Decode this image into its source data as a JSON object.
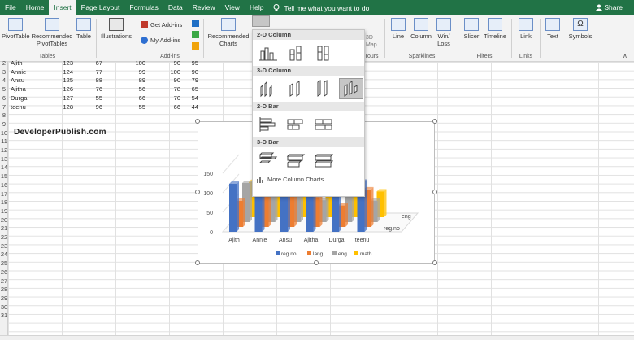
{
  "ribbon_tabs": [
    "File",
    "Home",
    "Insert",
    "Page Layout",
    "Formulas",
    "Data",
    "Review",
    "View",
    "Help"
  ],
  "active_tab": "Insert",
  "tell_me": "Tell me what you want to do",
  "share": "Share",
  "ribbon": {
    "pivottable": "PivotTable",
    "recommended_pivottables": "Recommended PivotTables",
    "table": "Table",
    "tables_group": "Tables",
    "illustrations": "Illustrations",
    "get_addins": "Get Add-ins",
    "my_addins": "My Add-ins",
    "addins_group": "Add-ins",
    "recommended_charts": "Recommended Charts",
    "tours_group": "Tours",
    "line": "Line",
    "column": "Column",
    "win_loss": "Win/ Loss",
    "sparklines_group": "Sparklines",
    "slicer": "Slicer",
    "timeline": "Timeline",
    "filters_group": "Filters",
    "link": "Link",
    "links_group": "Links",
    "text": "Text",
    "symbols": "Symbols",
    "map_partial": "3D",
    "map_partial2": "Map"
  },
  "rows": [
    {
      "num": "2",
      "name": "Ajith",
      "a": "123",
      "b": "67",
      "c": "100",
      "d": "90",
      "e": "95"
    },
    {
      "num": "3",
      "name": "Annie",
      "a": "124",
      "b": "77",
      "c": "99",
      "d": "100",
      "e": "90"
    },
    {
      "num": "4",
      "name": "Ansu",
      "a": "125",
      "b": "88",
      "c": "89",
      "d": "90",
      "e": "79"
    },
    {
      "num": "5",
      "name": "Ajitha",
      "a": "126",
      "b": "76",
      "c": "56",
      "d": "78",
      "e": "65"
    },
    {
      "num": "6",
      "name": "Durga",
      "a": "127",
      "b": "55",
      "c": "66",
      "d": "70",
      "e": "54"
    },
    {
      "num": "7",
      "name": "teenu",
      "a": "128",
      "b": "96",
      "c": "55",
      "d": "66",
      "e": "44"
    }
  ],
  "row_numbers": [
    "8",
    "9",
    "10",
    "11",
    "12",
    "13",
    "14",
    "15",
    "16",
    "17",
    "18",
    "19",
    "20",
    "21",
    "22",
    "23",
    "24",
    "25",
    "26",
    "27",
    "28",
    "29",
    "30",
    "31"
  ],
  "watermark": "DeveloperPublish.com",
  "dropdown": {
    "sections": [
      "2-D Column",
      "3-D Column",
      "2-D Bar",
      "3-D Bar"
    ],
    "more": "More Column Charts..."
  },
  "chart_data": {
    "type": "bar",
    "categories": [
      "Ajith",
      "Annie",
      "Ansu",
      "Ajitha",
      "Durga",
      "teenu"
    ],
    "series": [
      {
        "name": "reg.no",
        "values": [
          123,
          124,
          125,
          126,
          127,
          128
        ],
        "color": "#4472c4"
      },
      {
        "name": "lang",
        "values": [
          67,
          77,
          88,
          76,
          55,
          96
        ],
        "color": "#ed7d31"
      },
      {
        "name": "eng",
        "values": [
          100,
          99,
          89,
          56,
          66,
          55
        ],
        "color": "#a5a5a5"
      },
      {
        "name": "math",
        "values": [
          90,
          100,
          90,
          78,
          70,
          66
        ],
        "color": "#ffc000"
      }
    ],
    "y_ticks": [
      "0",
      "50",
      "100",
      "150"
    ],
    "depth_labels": [
      "eng",
      "reg.no"
    ],
    "ylim": [
      0,
      150
    ],
    "legend": "bottom"
  },
  "colors": {
    "accent": "#217346",
    "ribbon_bg": "#f3f3f3"
  }
}
